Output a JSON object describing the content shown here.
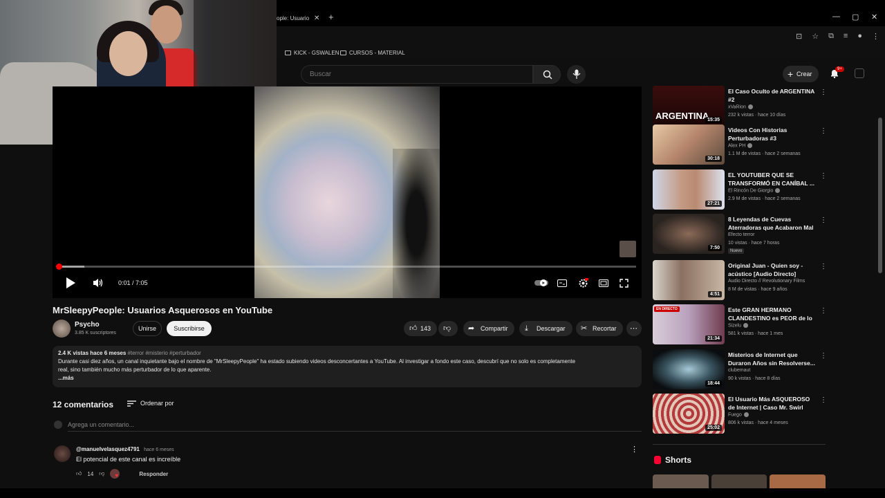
{
  "browser": {
    "tab_title": "ople: Usuario",
    "bookmarks": [
      "KICK - GSWALEN",
      "CURSOS - MATERIAL"
    ]
  },
  "topbar": {
    "search_placeholder": "Buscar",
    "create_label": "Crear",
    "notif_badge": "9+"
  },
  "player": {
    "time": "0:01 / 7:05",
    "progress_fraction": 0.002,
    "buffer_fraction": 0.045
  },
  "video": {
    "title": "MrSleepyPeople: Usuarios Asquerosos en YouTube",
    "channel": "Psycho",
    "subscribers": "3.85 K suscriptores",
    "join_label": "Unirse",
    "subscribe_label": "Suscribirse",
    "likes": "143",
    "share_label": "Compartir",
    "download_label": "Descargar",
    "clip_label": "Recortar"
  },
  "description": {
    "meta": "2.4 K vistas  hace 6 meses",
    "tags": "#terror #misterio #perturbador",
    "text1": "Durante casi diez años, un canal inquietante bajo el nombre de \"MrSleepyPeople\" ha estado subiendo videos desconcertantes a YouTube. Al investigar a fondo este caso, descubrí que no solo es completamente",
    "text2": "real, sino también mucho más perturbador de lo que aparente.",
    "more": "...más"
  },
  "comments": {
    "count": "12 comentarios",
    "sort_label": "Ordenar por",
    "input_placeholder": "Agrega un comentario...",
    "items": [
      {
        "user": "@manuelvelasquez4791",
        "time": "hace 6 meses",
        "text": "El potencial de este canal es increíble",
        "likes": "14",
        "reply_label": "Responder"
      }
    ]
  },
  "sidebar": {
    "items": [
      {
        "title": "El Caso Oculto de ARGENTINA #2",
        "channel": "xVaRion",
        "views": "232 k vistas · hace 10 días",
        "duration": "15:35",
        "thumb_text": "ARGENTINA"
      },
      {
        "title": "Videos Con Historias Perturbadoras #3",
        "channel": "Alex PH",
        "views": "1.1 M de vistas · hace 2 semanas",
        "duration": "30:18"
      },
      {
        "title": "EL YOUTUBER QUE SE TRANSFORMÓ EN CANÍBAL ...",
        "channel": "El Rincón De Giorgio",
        "views": "2.9 M de vistas · hace 2 semanas",
        "duration": "27:21"
      },
      {
        "title": "8 Leyendas de Cuevas Aterradoras que Acabaron Mal",
        "channel": "Efecto terror",
        "views": "10 vistas · hace 7 horas",
        "duration": "7:50",
        "badge": "Nuevo"
      },
      {
        "title": "Original Juan - Quien soy - acústico [Audio Directo]",
        "channel": "Audio Directo // Revolutionary Films",
        "views": "8 M de vistas · hace 9 años",
        "duration": "4:51"
      },
      {
        "title": "Este GRAN HERMANO CLANDESTINO es PEOR de lo ...",
        "channel": "Sizelu",
        "views": "581 k vistas · hace 1 mes",
        "duration": "21:34",
        "live": "EN DIRECTO"
      },
      {
        "title": "Misterios de Internet que Duraron Años sin Resolverse...",
        "channel": "clubemaut",
        "views": "90 k vistas · hace 8 días",
        "duration": "18:44"
      },
      {
        "title": "El Usuario Más ASQUEROSO de Internet | Caso Mr. Swirl",
        "channel": "Fuego",
        "views": "806 k vistas · hace 4 meses",
        "duration": "25:02"
      }
    ],
    "shorts_label": "Shorts"
  },
  "colors": {
    "accent": "#ff0000",
    "background": "#0f0f0f",
    "surface": "#272727"
  }
}
